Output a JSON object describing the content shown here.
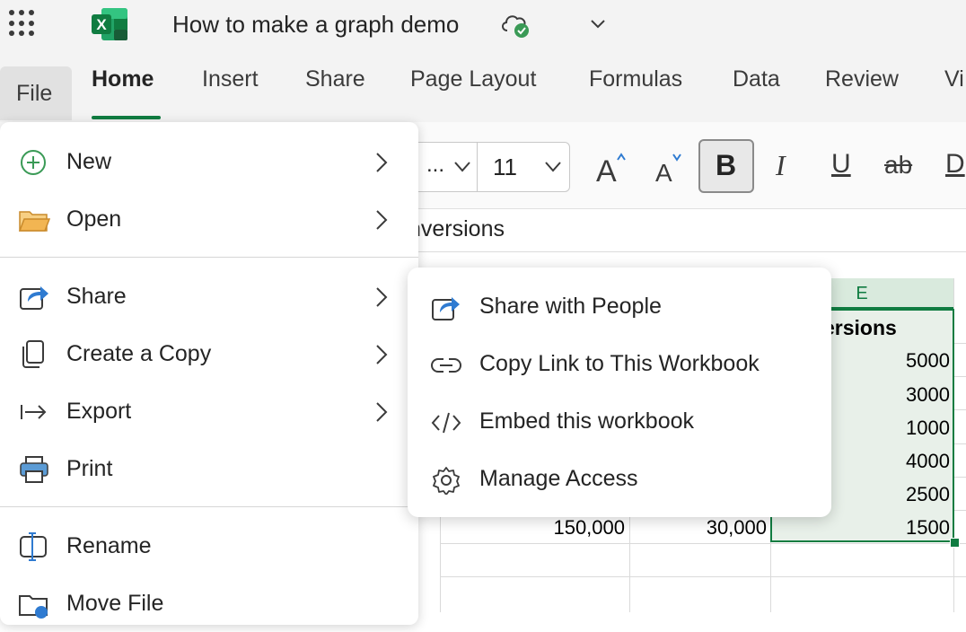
{
  "app": {
    "document_title": "How to make a graph demo",
    "logo_letter": "X"
  },
  "tabs": [
    {
      "label": "File"
    },
    {
      "label": "Home"
    },
    {
      "label": "Insert"
    },
    {
      "label": "Share"
    },
    {
      "label": "Page Layout"
    },
    {
      "label": "Formulas"
    },
    {
      "label": "Data"
    },
    {
      "label": "Review"
    },
    {
      "label": "Vi"
    }
  ],
  "ribbon": {
    "font_name": "...",
    "font_size": "11",
    "bold_label": "B",
    "italic_label": "I",
    "underline_label": "U",
    "strike_label": "ab",
    "overflow_label": "D"
  },
  "formula_bar": {
    "text": "nversions"
  },
  "sheet": {
    "column_e": "E",
    "header_cell": "ersions",
    "column_e_values": [
      "5000",
      "3000",
      "1000",
      "4000",
      "2500",
      "1500"
    ],
    "row_last_c": "150,000",
    "row_last_d": "30,000"
  },
  "file_menu": {
    "items": [
      {
        "label": "New",
        "icon": "plus-circle-icon",
        "has_submenu": true
      },
      {
        "label": "Open",
        "icon": "folder-icon",
        "has_submenu": true
      },
      {
        "label": "Share",
        "icon": "share-arrow-icon",
        "has_submenu": true
      },
      {
        "label": "Create a Copy",
        "icon": "copy-icon",
        "has_submenu": true
      },
      {
        "label": "Export",
        "icon": "export-icon",
        "has_submenu": true
      },
      {
        "label": "Print",
        "icon": "printer-icon",
        "has_submenu": false
      },
      {
        "label": "Rename",
        "icon": "rename-icon",
        "has_submenu": false
      },
      {
        "label": "Move File",
        "icon": "move-file-icon",
        "has_submenu": false
      }
    ]
  },
  "share_submenu": {
    "items": [
      {
        "label": "Share with People",
        "icon": "share-arrow-icon"
      },
      {
        "label": "Copy Link to This Workbook",
        "icon": "link-icon"
      },
      {
        "label": "Embed this workbook",
        "icon": "code-icon"
      },
      {
        "label": "Manage Access",
        "icon": "gear-icon"
      }
    ]
  },
  "colors": {
    "excel_green": "#107c41",
    "selection_fill": "#e8f0e9",
    "share_blue": "#2f7bd1",
    "new_green": "#3a9a56",
    "folder_orange": "#e39a3b"
  }
}
